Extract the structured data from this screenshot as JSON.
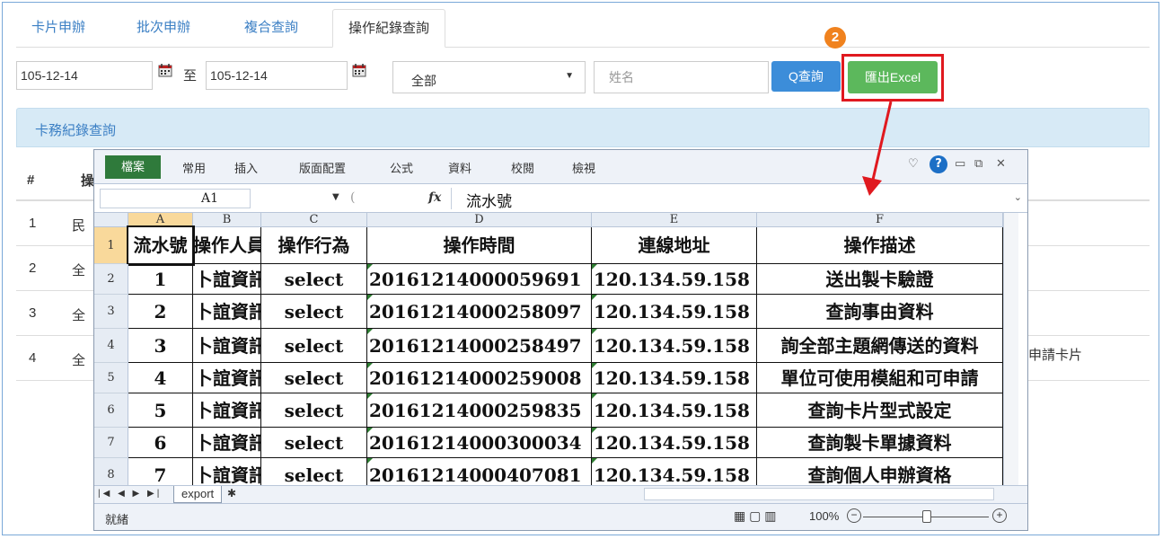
{
  "tabs": [
    "卡片申辦",
    "批次申辦",
    "複合查詢",
    "操作紀錄查詢"
  ],
  "filters": {
    "date_from": "105-12-14",
    "to_label": "至",
    "date_to": "105-12-14",
    "select_value": "全部",
    "name_placeholder": "姓名",
    "search_label": "Q查詢",
    "export_label": "匯出Excel",
    "step_badge": "2"
  },
  "panel": {
    "title": "卡務紀錄查詢",
    "header_hash": "#",
    "header_partial": "操",
    "rows": [
      {
        "num": "1",
        "ch": "民"
      },
      {
        "num": "2",
        "ch": "全"
      },
      {
        "num": "3",
        "ch": "全"
      },
      {
        "num": "4",
        "ch": "全"
      }
    ],
    "row4_tail": "申請卡片"
  },
  "excel": {
    "file_tab": "檔案",
    "ribbon_tabs": [
      "常用",
      "插入",
      "版面配置",
      "公式",
      "資料",
      "校閱",
      "檢視"
    ],
    "name_box": "A1",
    "formula": "流水號",
    "fx_label": "fx",
    "col_headers": [
      "A",
      "B",
      "C",
      "D",
      "E",
      "F"
    ],
    "header_row": [
      "流水號",
      "操作人員",
      "操作行為",
      "操作時間",
      "連線地址",
      "操作描述"
    ],
    "rows": [
      [
        "1",
        "卜誼資訊",
        "select",
        "20161214000059691",
        "120.134.59.158",
        "送出製卡驗證"
      ],
      [
        "2",
        "卜誼資訊",
        "select",
        "20161214000258097",
        "120.134.59.158",
        "查詢事由資料"
      ],
      [
        "3",
        "卜誼資訊",
        "select",
        "20161214000258497",
        "120.134.59.158",
        "詢全部主題網傳送的資料"
      ],
      [
        "4",
        "卜誼資訊",
        "select",
        "20161214000259008",
        "120.134.59.158",
        "單位可使用模組和可申請"
      ],
      [
        "5",
        "卜誼資訊",
        "select",
        "20161214000259835",
        "120.134.59.158",
        "查詢卡片型式設定"
      ],
      [
        "6",
        "卜誼資訊",
        "select",
        "20161214000300034",
        "120.134.59.158",
        "查詢製卡單據資料"
      ],
      [
        "7",
        "卜誼資訊",
        "select",
        "20161214000407081",
        "120.134.59.158",
        "查詢個人申辦資格"
      ]
    ],
    "row_numbers": [
      "1",
      "2",
      "3",
      "4",
      "5",
      "6",
      "7",
      "8"
    ],
    "sheet_tab": "export",
    "status_ready": "就緒",
    "zoom": "100%"
  },
  "colors": {
    "accent": "#3b7fc4",
    "search_button": "#3c8dd9",
    "excel_button": "#5cb85c",
    "highlight": "#e0191f",
    "badge": "#f0821e",
    "excel_file_tab": "#2f7a3b"
  }
}
